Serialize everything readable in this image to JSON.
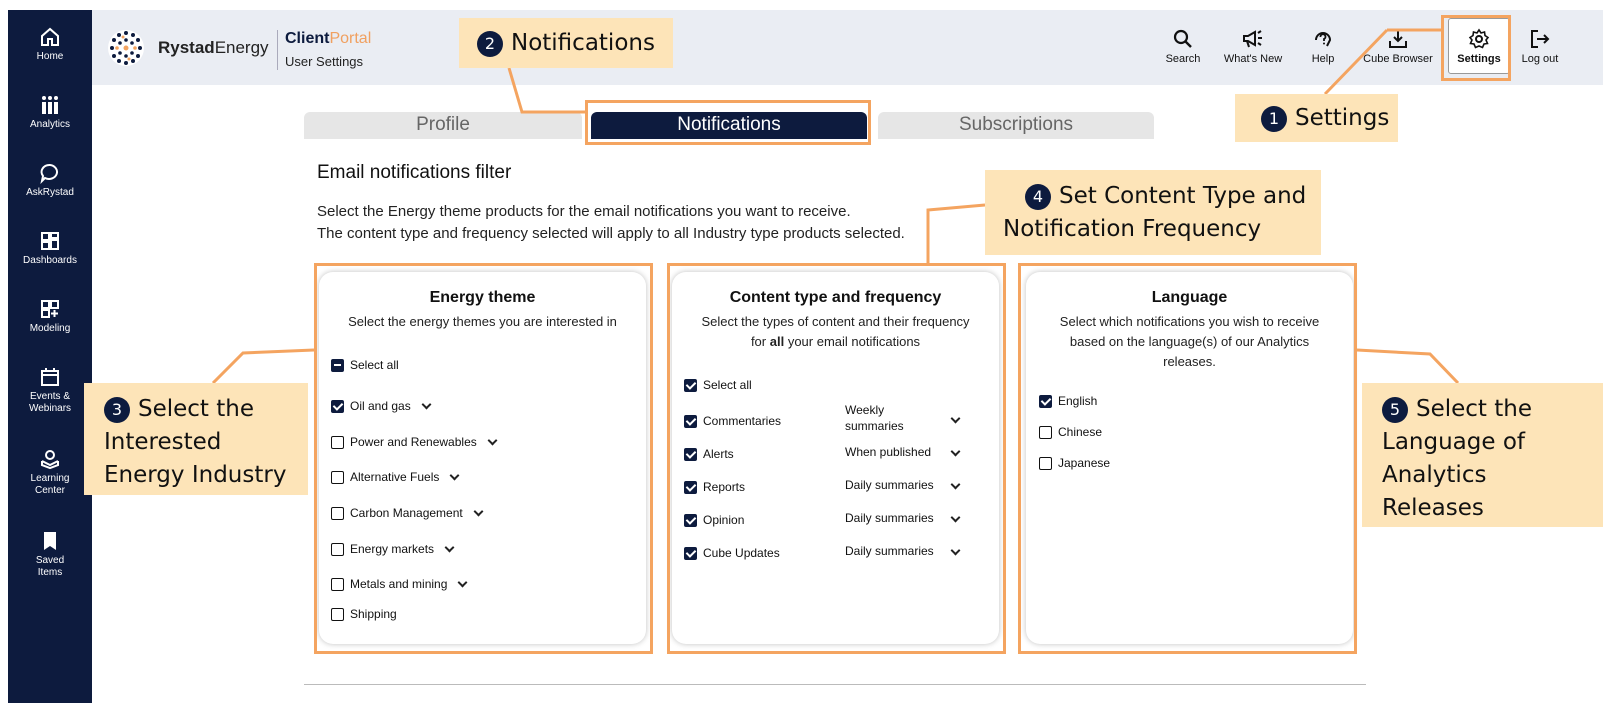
{
  "leftnav": {
    "items": [
      {
        "label": "Home",
        "icon": "home-icon"
      },
      {
        "label": "Analytics",
        "icon": "analytics-icon"
      },
      {
        "label": "AskRystad",
        "icon": "chat-bubble-icon"
      },
      {
        "label": "Dashboards",
        "icon": "dashboard-icon"
      },
      {
        "label": "Modeling",
        "icon": "modeling-icon"
      },
      {
        "label": "Events &",
        "label2": "Webinars",
        "icon": "calendar-icon"
      },
      {
        "label": "Learning",
        "label2": "Center",
        "icon": "learning-icon"
      },
      {
        "label": "Saved",
        "label2": "Items",
        "icon": "bookmark-icon"
      }
    ]
  },
  "header": {
    "brand_bold": "Rystad",
    "brand_rest": "Energy",
    "portal_client": "Client",
    "portal_portal": "Portal",
    "subtitle": "User Settings",
    "buttons": [
      {
        "label": "Search",
        "icon": "search-icon"
      },
      {
        "label": "What's New",
        "icon": "megaphone-icon"
      },
      {
        "label": "Help",
        "icon": "help-icon"
      },
      {
        "label": "Cube Browser",
        "icon": "download-icon"
      },
      {
        "label": "Settings",
        "icon": "gear-icon"
      },
      {
        "label": "Log out",
        "icon": "logout-icon"
      }
    ]
  },
  "tabs": [
    {
      "label": "Profile",
      "active": false
    },
    {
      "label": "Notifications",
      "active": true
    },
    {
      "label": "Subscriptions",
      "active": false
    }
  ],
  "main": {
    "title": "Email notifications filter",
    "desc1": "Select the Energy theme products for the email notifications you want to receive.",
    "desc2": "The content type and frequency selected will apply to all Industry type products selected."
  },
  "energy": {
    "title": "Energy theme",
    "subtitle": "Select the energy themes you are interested in",
    "select_all": "Select all",
    "items": [
      {
        "label": "Oil and gas",
        "checked": true
      },
      {
        "label": "Power and Renewables",
        "checked": false
      },
      {
        "label": "Alternative Fuels",
        "checked": false
      },
      {
        "label": "Carbon Management",
        "checked": false
      },
      {
        "label": "Energy markets",
        "checked": false
      },
      {
        "label": "Metals and mining",
        "checked": false
      },
      {
        "label": "Shipping",
        "checked": false
      }
    ]
  },
  "content": {
    "title": "Content type and frequency",
    "subtitle_a": "Select the types of content and their frequency",
    "subtitle_b1": "for ",
    "subtitle_b2": "all",
    "subtitle_b3": " your email notifications",
    "select_all": "Select all",
    "items": [
      {
        "label": "Commentaries",
        "freq": "Weekly",
        "freq2": "summaries"
      },
      {
        "label": "Alerts",
        "freq": "When published"
      },
      {
        "label": "Reports",
        "freq": "Daily summaries"
      },
      {
        "label": "Opinion",
        "freq": "Daily summaries"
      },
      {
        "label": "Cube Updates",
        "freq": "Daily summaries"
      }
    ]
  },
  "language": {
    "title": "Language",
    "subtitle_a": "Select which notifications you wish to receive",
    "subtitle_b": "based on the language(s) of our Analytics",
    "subtitle_c": "releases.",
    "items": [
      {
        "label": "English",
        "checked": true
      },
      {
        "label": "Chinese",
        "checked": false
      },
      {
        "label": "Japanese",
        "checked": false
      }
    ]
  },
  "callouts": {
    "c1": {
      "num": "1",
      "text": "Settings"
    },
    "c2": {
      "num": "2",
      "text": "Notifications"
    },
    "c3": {
      "num": "3",
      "l1": "Select the",
      "l2": "Interested",
      "l3": "Energy Industry"
    },
    "c4": {
      "num": "4",
      "l1": "Set Content Type and",
      "l2": "Notification Frequency"
    },
    "c5": {
      "num": "5",
      "l1": "Select the",
      "l2": "Language of",
      "l3": "Analytics",
      "l4": "Releases"
    }
  },
  "colors": {
    "navy": "#0d1b3e",
    "annotation_orange": "#f4a460",
    "callout_bg": "#fde4b8"
  }
}
